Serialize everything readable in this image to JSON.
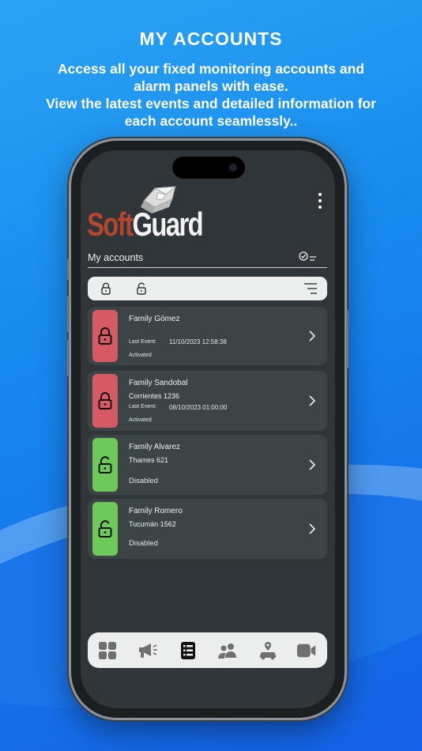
{
  "promo": {
    "headline": "MY ACCOUNTS",
    "lines": [
      "Access all your fixed monitoring accounts and",
      "alarm panels with ease.",
      "View the latest events and detailed information for",
      "each account seamlessly.."
    ]
  },
  "app": {
    "logo": {
      "soft": "Soft",
      "guard": "Guard"
    },
    "page_title": "My accounts",
    "menu_icon": "kebab-menu-icon",
    "filters": {
      "locked_icon": "lock-closed-icon",
      "unlocked_icon": "lock-open-icon",
      "sort_icon": "sort-lines-icon"
    },
    "colors": {
      "armed": "#d65a63",
      "disarmed": "#6cc95a",
      "card_bg": "#3d4446",
      "screen_bg": "#2f3538"
    },
    "accounts": [
      {
        "name": "Family Gómez",
        "address": "",
        "last_event_label": "Last Event:",
        "last_event": "11/10/2023 12:58:38",
        "status": "Activated",
        "state": "armed"
      },
      {
        "name": "Family Sandobal",
        "address": "Corrientes 1236",
        "last_event_label": "Last Event:",
        "last_event": "08/10/2023 01:00:00",
        "status": "Activated",
        "state": "armed"
      },
      {
        "name": "Family Alvarez",
        "address": "Thames 621",
        "last_event_label": "",
        "last_event": "",
        "status": "Disabled",
        "state": "disarmed"
      },
      {
        "name": "Family Romero",
        "address": "Tucumán 1562",
        "last_event_label": "",
        "last_event": "",
        "status": "Disabled",
        "state": "disarmed"
      }
    ],
    "bottom_nav": [
      {
        "icon": "dashboard-grid-icon"
      },
      {
        "icon": "megaphone-icon"
      },
      {
        "icon": "accounts-list-icon",
        "active": true
      },
      {
        "icon": "users-icon"
      },
      {
        "icon": "vehicle-location-icon"
      },
      {
        "icon": "video-camera-icon"
      }
    ]
  }
}
